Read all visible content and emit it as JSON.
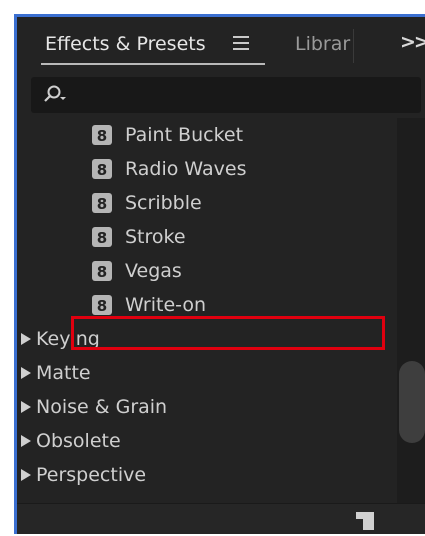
{
  "tabs": {
    "active_label": "Effects & Presets",
    "library_label": "Librar"
  },
  "icons": {
    "panel_menu": "hamburger-menu-icon",
    "overflow": "double-chevron-right-icon",
    "search": "search-icon",
    "preset": "preset-8-icon",
    "expand": "disclosure-triangle-right-icon",
    "new_folder": "new-folder-icon"
  },
  "colors": {
    "panel_bg": "#232323",
    "focus_border": "#3b6fd0",
    "highlight_box": "#e0000f",
    "text": "#cfcfcf"
  },
  "presets": [
    {
      "label": "Paint Bucket"
    },
    {
      "label": "Radio Waves"
    },
    {
      "label": "Scribble"
    },
    {
      "label": "Stroke"
    },
    {
      "label": "Vegas"
    },
    {
      "label": "Write-on"
    }
  ],
  "categories": [
    {
      "label": "Keying"
    },
    {
      "label": "Matte"
    },
    {
      "label": "Noise & Grain"
    },
    {
      "label": "Obsolete"
    },
    {
      "label": "Perspective"
    }
  ],
  "highlighted_item": "Stroke"
}
